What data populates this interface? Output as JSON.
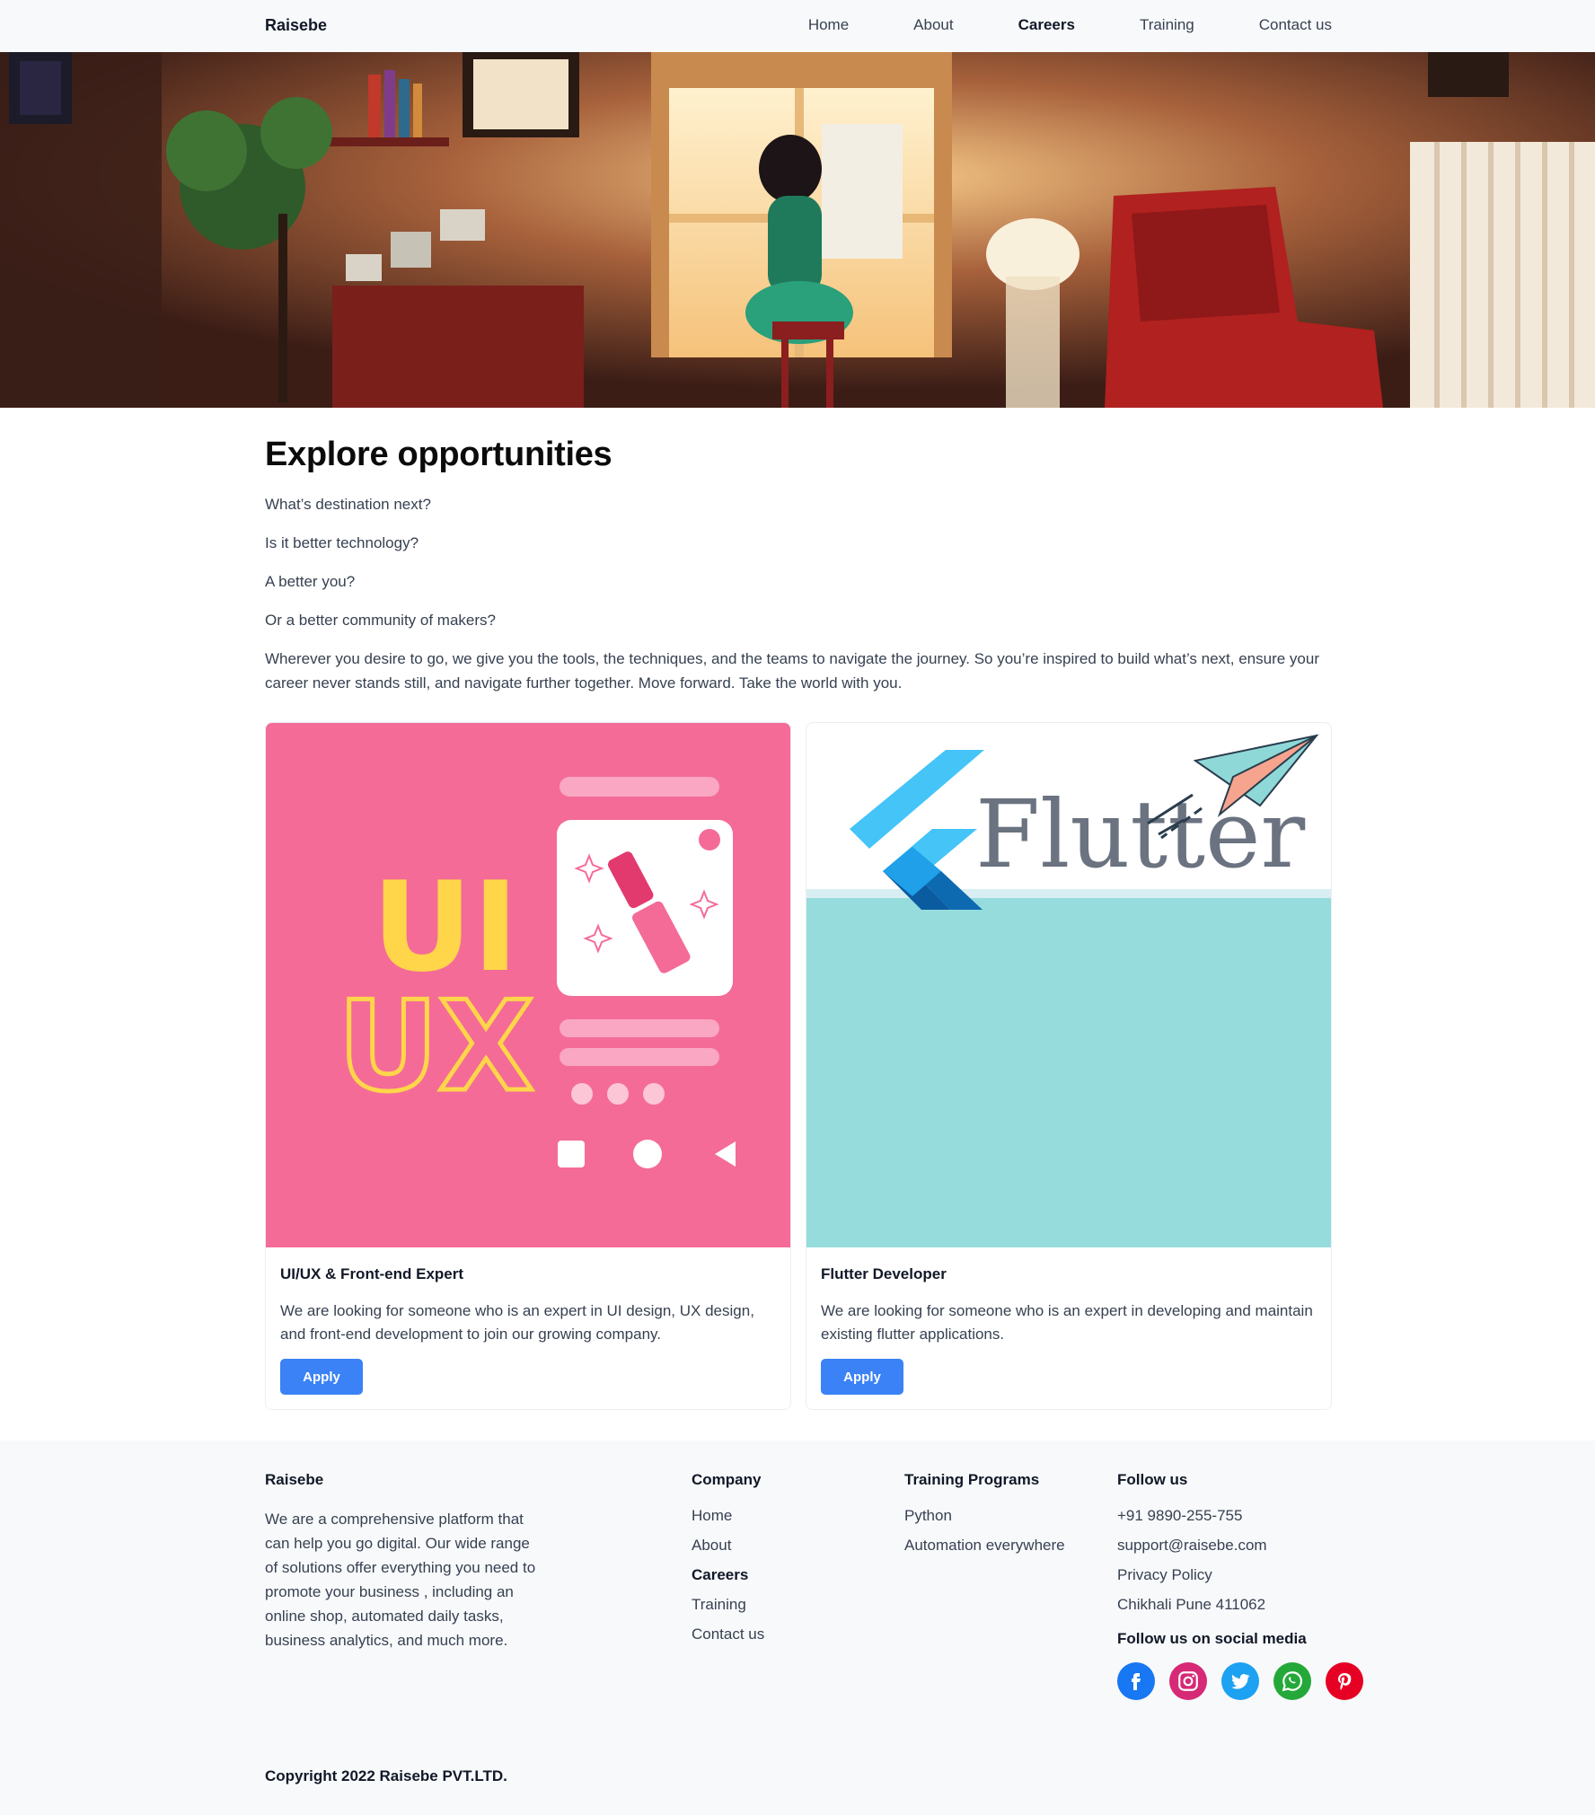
{
  "nav": {
    "brand": "Raisebe",
    "links": [
      {
        "label": "Home",
        "active": false
      },
      {
        "label": "About",
        "active": false
      },
      {
        "label": "Careers",
        "active": true
      },
      {
        "label": "Training",
        "active": false
      },
      {
        "label": "Contact us",
        "active": false
      }
    ]
  },
  "hero": {
    "image": "illustration-woman-painting-by-window"
  },
  "intro": {
    "heading": "Explore opportunities",
    "lines": [
      "What’s destination next?",
      "Is it better technology?",
      "A better you?",
      "Or a better community of makers?"
    ],
    "paragraph": "Wherever you desire to go, we give you the tools, the techniques, and the teams to navigate the journey. So you’re inspired to build what’s next, ensure your career never stands still, and navigate further together. Move forward. Take the world with you."
  },
  "cards": [
    {
      "image_text_top": "UI",
      "image_text_bottom": "UX",
      "title": "UI/UX & Front-end Expert",
      "description": "We are looking for someone who is an expert in UI design, UX design, and front-end development to join our growing company.",
      "button": "Apply"
    },
    {
      "image_text": "Flutter",
      "title": "Flutter Developer",
      "description": "We are looking for someone who is an expert in developing and maintain existing flutter applications.",
      "button": "Apply"
    }
  ],
  "footer": {
    "brand": "Raisebe",
    "about": "We are a comprehensive platform that can help you go digital. Our wide range of solutions offer everything you need to promote your business , including an online shop, automated daily tasks, business analytics, and much more.",
    "company": {
      "heading": "Company",
      "links": [
        "Home",
        "About",
        "Careers",
        "Training",
        "Contact us"
      ]
    },
    "training": {
      "heading": "Training Programs",
      "links": [
        "Python",
        "Automation everywhere"
      ]
    },
    "follow": {
      "heading": "Follow us",
      "items": [
        "+91 9890-255-755",
        "support@raisebe.com",
        "Privacy Policy",
        "Chikhali Pune 411062"
      ],
      "social_heading": "Follow us on social media",
      "social": [
        {
          "name": "facebook-icon",
          "color": "#1877f2"
        },
        {
          "name": "instagram-icon",
          "color": "#d62976"
        },
        {
          "name": "twitter-icon",
          "color": "#1da1f2"
        },
        {
          "name": "whatsapp-icon",
          "color": "#25a83a"
        },
        {
          "name": "pinterest-icon",
          "color": "#e60023"
        }
      ]
    },
    "copyright": "Copyright 2022 Raisebe PVT.LTD."
  },
  "colors": {
    "accent": "#3b82f6",
    "uiux_bg": "#f46b97",
    "uiux_yellow": "#ffd54a",
    "flutter_bg": "#96dcdd",
    "flutter_blue": "#45c4f8"
  }
}
